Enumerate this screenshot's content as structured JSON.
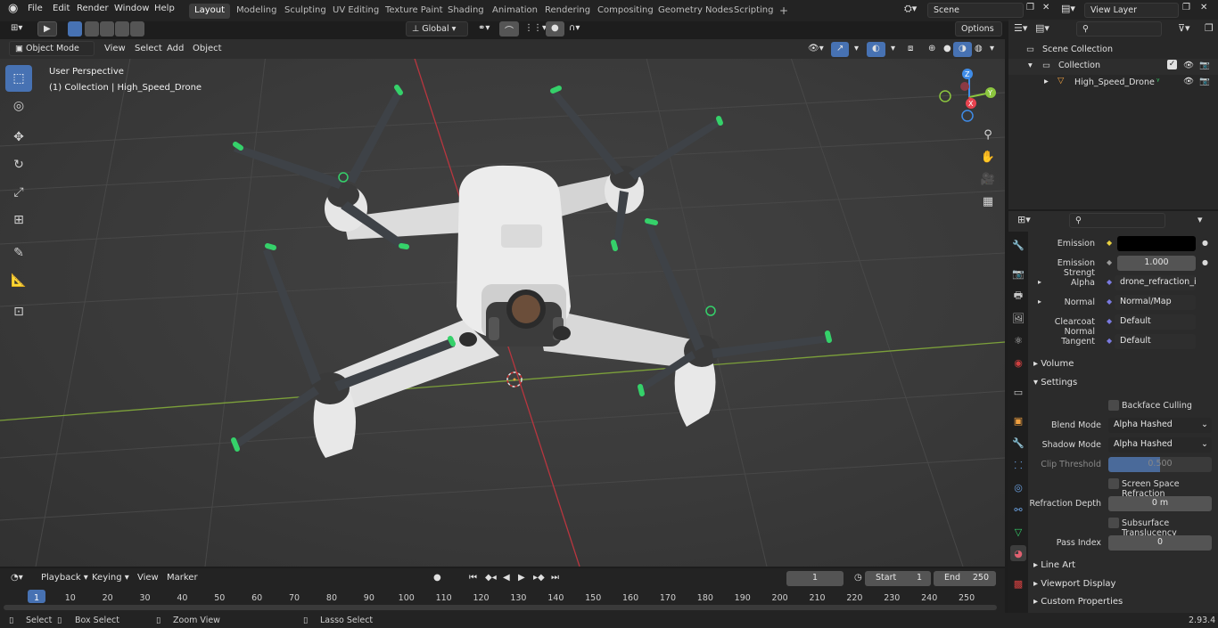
{
  "topbar": {
    "menus": [
      "File",
      "Edit",
      "Render",
      "Window",
      "Help"
    ],
    "workspaces": [
      "Layout",
      "Modeling",
      "Sculpting",
      "UV Editing",
      "Texture Paint",
      "Shading",
      "Animation",
      "Rendering",
      "Compositing",
      "Geometry Nodes",
      "Scripting"
    ],
    "active_workspace": "Layout",
    "scene": "Scene",
    "view_layer": "View Layer"
  },
  "viewport_header": {
    "mode": "Object Mode",
    "menus": [
      "View",
      "Select",
      "Add",
      "Object"
    ],
    "transform_orientation": "Global",
    "options": "Options"
  },
  "viewport": {
    "perspective": "User Perspective",
    "collection_info": "(1) Collection | High_Speed_Drone",
    "axis_labels": {
      "z": "Z",
      "y": "Y",
      "x": "X"
    }
  },
  "outliner": {
    "root": "Scene Collection",
    "collection": "Collection",
    "object": "High_Speed_Drone"
  },
  "properties": {
    "emission_label": "Emission",
    "emission_strength_label": "Emission Strengt",
    "emission_strength": "1.000",
    "alpha_label": "Alpha",
    "alpha_value": "drone_refraction_inv...",
    "normal_label": "Normal",
    "normal_value": "Normal/Map",
    "clearcoat_label": "Clearcoat Normal",
    "clearcoat_value": "Default",
    "tangent_label": "Tangent",
    "tangent_value": "Default",
    "volume_panel": "Volume",
    "settings_panel": "Settings",
    "backface_culling": "Backface Culling",
    "blend_mode_label": "Blend Mode",
    "blend_mode": "Alpha Hashed",
    "shadow_mode_label": "Shadow Mode",
    "shadow_mode": "Alpha Hashed",
    "clip_threshold_label": "Clip Threshold",
    "clip_threshold": "0.500",
    "ssr": "Screen Space Refraction",
    "refraction_depth_label": "Refraction Depth",
    "refraction_depth": "0 m",
    "subsurface": "Subsurface Translucency",
    "pass_index_label": "Pass Index",
    "pass_index": "0",
    "line_art": "Line Art",
    "viewport_display": "Viewport Display",
    "custom_properties": "Custom Properties"
  },
  "timeline": {
    "menus": [
      "Playback",
      "Keying",
      "View",
      "Marker"
    ],
    "current_frame": "1",
    "start_label": "Start",
    "start": "1",
    "end_label": "End",
    "end": "250",
    "ticks": [
      "1",
      "10",
      "20",
      "30",
      "40",
      "50",
      "60",
      "70",
      "80",
      "90",
      "100",
      "110",
      "120",
      "130",
      "140",
      "150",
      "160",
      "170",
      "180",
      "190",
      "200",
      "210",
      "220",
      "230",
      "240",
      "250"
    ]
  },
  "statusbar": {
    "select": "Select",
    "box_select": "Box Select",
    "zoom_view": "Zoom View",
    "lasso_select": "Lasso Select",
    "version": "2.93.4"
  },
  "colors": {
    "accent": "#4772b3",
    "x_axis": "#e8434f",
    "y_axis": "#8cc63f",
    "z_axis": "#3f8ce8",
    "prop_tip": "#35d16a"
  }
}
